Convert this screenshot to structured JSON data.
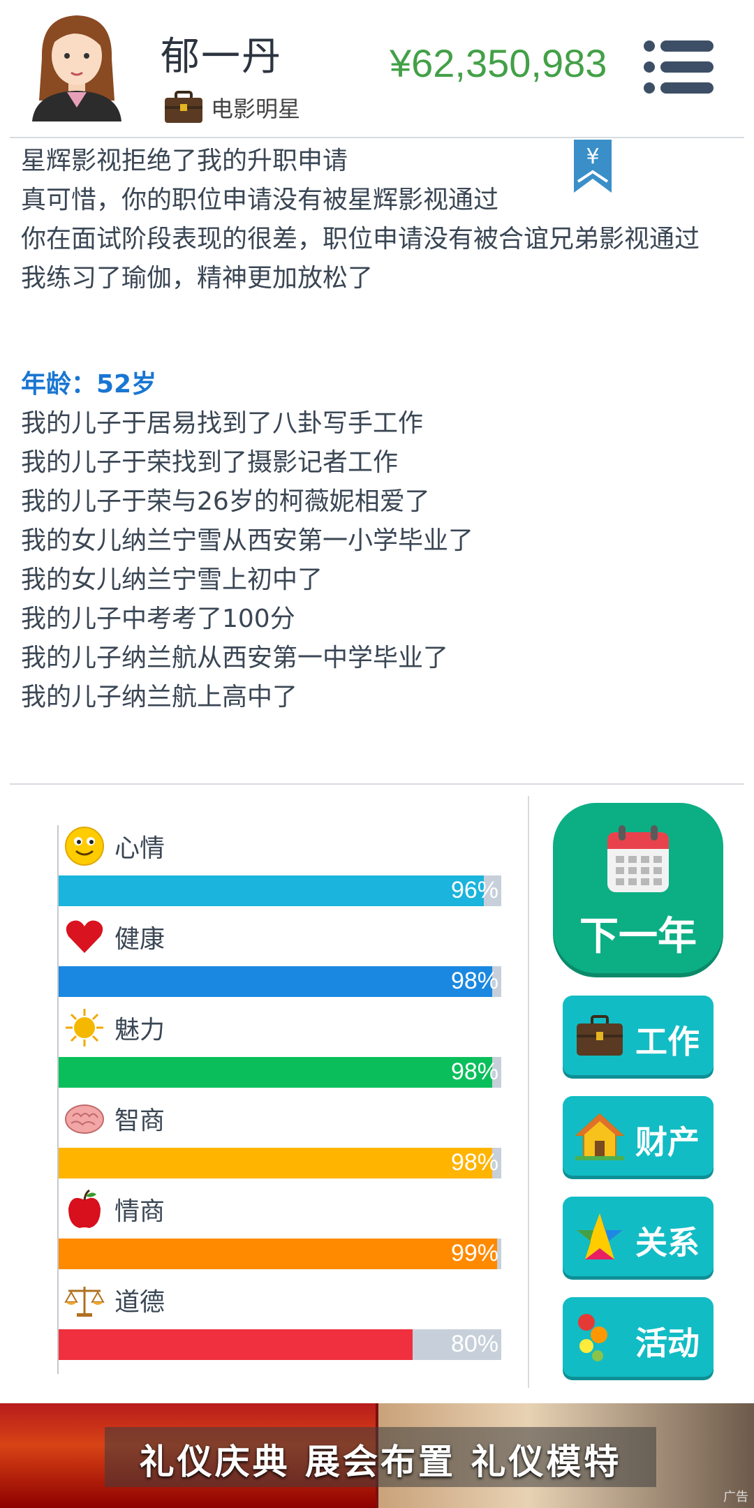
{
  "player": {
    "name": "郁一丹",
    "job": "电影明星",
    "money": "¥62,350,983"
  },
  "bookmark": {
    "symbol": "¥"
  },
  "log": {
    "lines_top": [
      "星辉影视拒绝了我的升职申请",
      "真可惜，你的职位申请没有被星辉影视通过",
      "你在面试阶段表现的很差，职位申请没有被合谊兄弟影视通过",
      "我练习了瑜伽，精神更加放松了"
    ],
    "age": "年龄：52岁",
    "lines_bottom": [
      "我的儿子于居易找到了八卦写手工作",
      "我的儿子于荣找到了摄影记者工作",
      "我的儿子于荣与26岁的柯薇妮相爱了",
      "我的女儿纳兰宁雪从西安第一小学毕业了",
      "我的女儿纳兰宁雪上初中了",
      "我的儿子中考考了100分",
      "我的儿子纳兰航从西安第一中学毕业了",
      "我的儿子纳兰航上高中了"
    ]
  },
  "stats": [
    {
      "label": "心情",
      "icon": "smiley-icon",
      "value": 96,
      "pct": "96%",
      "color": "#1ab4dc"
    },
    {
      "label": "健康",
      "icon": "heart-icon",
      "value": 98,
      "pct": "98%",
      "color": "#1a88e0"
    },
    {
      "label": "魅力",
      "icon": "sun-icon",
      "value": 98,
      "pct": "98%",
      "color": "#0abf5b"
    },
    {
      "label": "智商",
      "icon": "brain-icon",
      "value": 98,
      "pct": "98%",
      "color": "#ffb400"
    },
    {
      "label": "情商",
      "icon": "apple-icon",
      "value": 99,
      "pct": "99%",
      "color": "#ff8a00"
    },
    {
      "label": "道德",
      "icon": "scales-icon",
      "value": 80,
      "pct": "80%",
      "color": "#f0303f"
    }
  ],
  "actions": {
    "next_year": "下一年",
    "work": "工作",
    "property": "财产",
    "relations": "关系",
    "activity": "活动"
  },
  "ad": {
    "text": "礼仪庆典  展会布置  礼仪模特",
    "tag": "广告"
  }
}
